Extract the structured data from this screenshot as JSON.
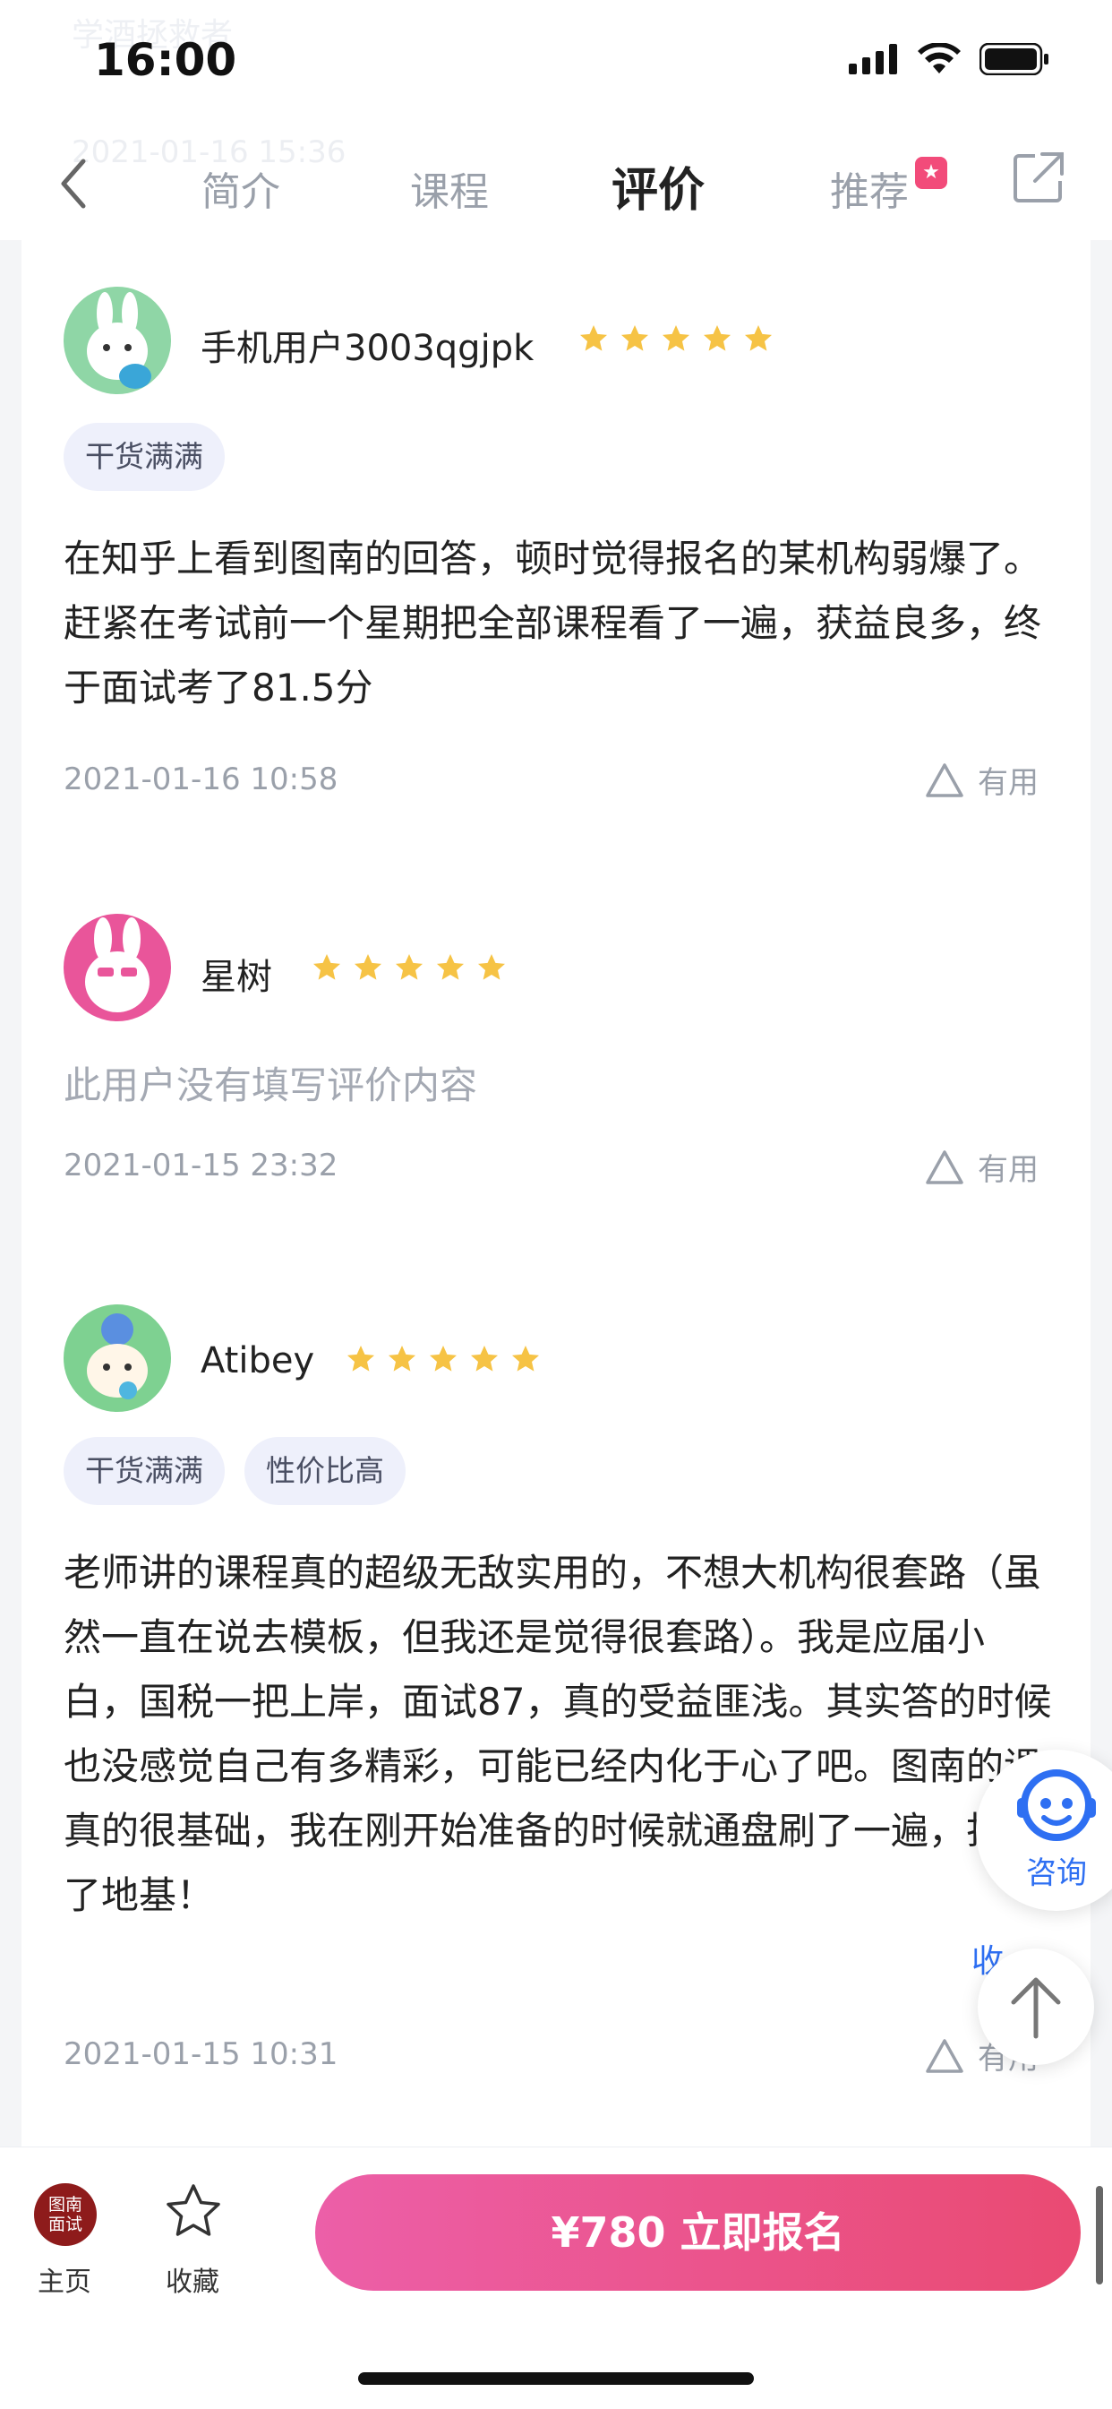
{
  "status_bar": {
    "time": "16:00",
    "ghost_text": "学酒拯救者"
  },
  "nav": {
    "ghost_date": "2021-01-16 15:36",
    "tabs": [
      {
        "label": "简介",
        "active": false
      },
      {
        "label": "课程",
        "active": false
      },
      {
        "label": "评价",
        "active": true
      },
      {
        "label": "推荐",
        "active": false
      }
    ],
    "icons": [
      "back-arrow-icon",
      "share-icon"
    ]
  },
  "reviews": [
    {
      "username": "手机用户3003qgjpk",
      "rating": 5,
      "tags": [
        "干货满满"
      ],
      "text": "在知乎上看到图南的回答，顿时觉得报名的某机构弱爆了。赶紧在考试前一个星期把全部课程看了一遍，获益良多，终于面试考了81.5分",
      "date": "2021-01-16 10:58",
      "useful_label": "有用"
    },
    {
      "username": "星树",
      "rating": 5,
      "tags": [],
      "text": "此用户没有填写评价内容",
      "date": "2021-01-15 23:32",
      "useful_label": "有用"
    },
    {
      "username": "Atibey",
      "rating": 5,
      "tags": [
        "干货满满",
        "性价比高"
      ],
      "text": "老师讲的课程真的超级无敌实用的，不想大机构很套路（虽然一直在说去模板，但我还是觉得很套路）。我是应届小白，国税一把上岸，面试87，真的受益匪浅。其实答的时候也没感觉自己有多精彩，可能已经内化于心了吧。图南的课真的很基础，我在刚开始准备的时候就通盘刷了一遍，打好了地基！",
      "date": "2021-01-15 10:31",
      "useful_label": "有用",
      "collapse_label": "收"
    }
  ],
  "floating": {
    "consult_label": "咨询"
  },
  "bottom_bar": {
    "home_logo_text_1": "图南",
    "home_logo_text_2": "面试",
    "home_label": "主页",
    "favorite_label": "收藏",
    "enroll_label": "¥780  立即报名"
  },
  "colors": {
    "accent_pink": "#ea4a72",
    "star": "#f6c345",
    "consult_blue": "#2e6ff2"
  }
}
